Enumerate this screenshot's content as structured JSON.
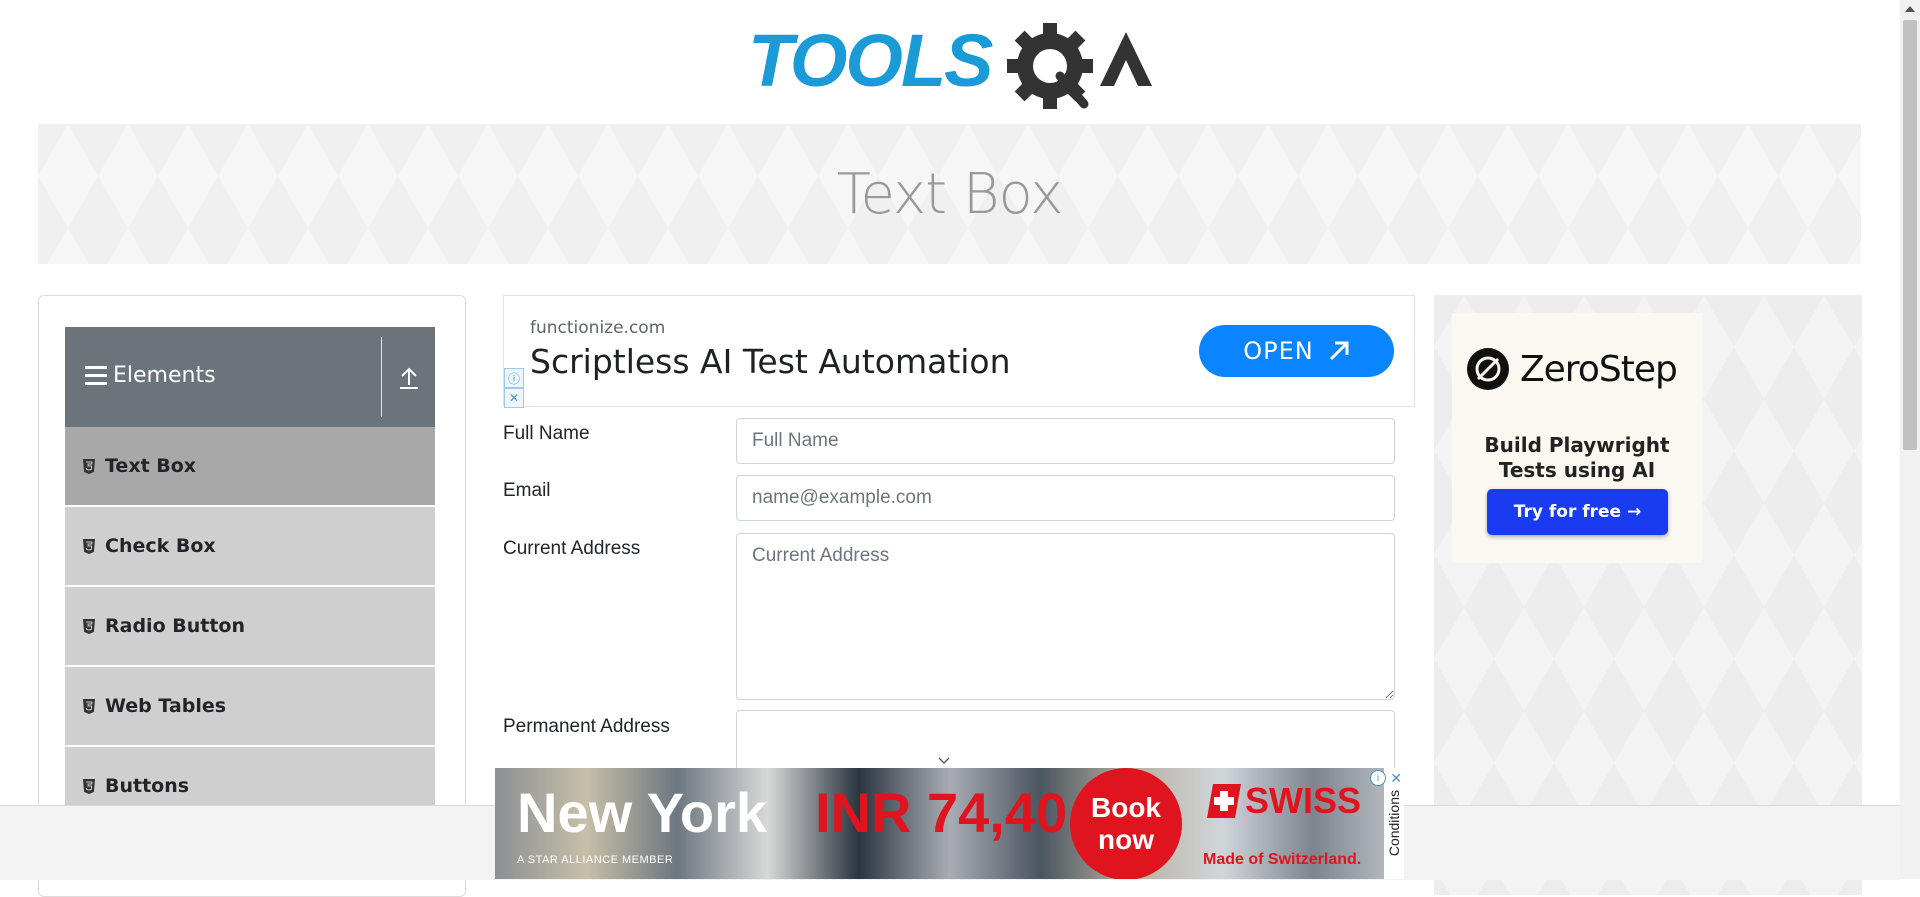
{
  "header": {
    "logo_text": "TOOLSQA"
  },
  "banner": {
    "title": "Text Box"
  },
  "sidebar": {
    "group_title": "Elements",
    "items": [
      {
        "label": "Text Box",
        "active": true
      },
      {
        "label": "Check Box",
        "active": false
      },
      {
        "label": "Radio Button",
        "active": false
      },
      {
        "label": "Web Tables",
        "active": false
      },
      {
        "label": "Buttons",
        "active": false
      }
    ]
  },
  "ad_top": {
    "domain": "functionize.com",
    "headline": "Scriptless AI Test Automation",
    "cta": "OPEN",
    "info_icon": "info-icon",
    "close_icon": "close-icon"
  },
  "form": {
    "full_name": {
      "label": "Full Name",
      "placeholder": "Full Name",
      "value": ""
    },
    "email": {
      "label": "Email",
      "placeholder": "name@example.com",
      "value": ""
    },
    "current_address": {
      "label": "Current Address",
      "placeholder": "Current Address",
      "value": ""
    },
    "permanent_address": {
      "label": "Permanent Address",
      "value": ""
    }
  },
  "ad_right": {
    "brand": "ZeroStep",
    "tagline_line1": "Build Playwright",
    "tagline_line2": "Tests using AI",
    "cta": "Try for free →"
  },
  "ad_bottom": {
    "city": "New York",
    "price": "INR 74,40",
    "cta_line1": "Book",
    "cta_line2": "now",
    "brand": "SWISS",
    "tagline": "Made of Switzerland.",
    "alliance": "A STAR ALLIANCE MEMBER",
    "conditions": "Conditions"
  },
  "colors": {
    "logo_blue": "#1a9ad6",
    "logo_dark": "#333333",
    "sidebar_header": "#6b737b",
    "sidebar_item": "#cfcfcf",
    "sidebar_item_active": "#a8a8a8",
    "ad_open_button": "#0a84ff",
    "zerostep_button": "#1a3cf0",
    "swiss_red": "#e0141e"
  }
}
